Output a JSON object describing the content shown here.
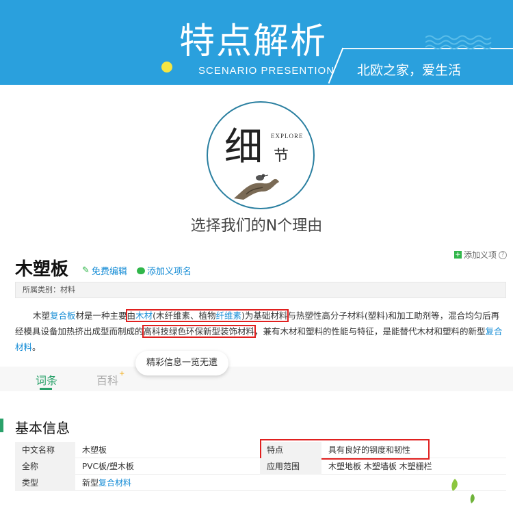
{
  "banner": {
    "title": "特点解析",
    "subtitle": "SCENARIO PRESENTION",
    "slogan": "北欧之家，爱生活"
  },
  "emblem": {
    "big_char": "细",
    "explore": "EXPLORE",
    "small_char": "节",
    "reasons": "选择我们的N个理由"
  },
  "entry": {
    "title": "木塑板",
    "edit_label": "免费编辑",
    "add_term_label": "添加义项名",
    "add_tip": "添加义项",
    "help": "?",
    "category_prefix": "所属类别：",
    "category_value": "材料"
  },
  "summary": {
    "s1": "木塑",
    "l1": "复合板",
    "s2": "材是一种主要",
    "h1a": "由",
    "h1b": "木材",
    "h1c": "(木纤维素、植物",
    "h1d": "纤维素",
    "h1e": ")为基础材料",
    "s3": "与热塑性高分子材料(塑料)和加工助剂等，混合均匀后再经模具设备加热挤出成型而制成的",
    "h2": "高科技绿色环保新型装饰材料",
    "s4": "，兼有木材和塑料的性能与特征，是能替代木材和塑料的新型",
    "l2": "复合材料",
    "s5": "。"
  },
  "tabs": {
    "active": "词条",
    "inactive": "百科",
    "star": "+",
    "pill": "精彩信息一览无遗"
  },
  "basic_info": {
    "title": "基本信息",
    "rows": [
      {
        "k1": "中文名称",
        "v1": "木塑板",
        "k2": "特点",
        "v2": "具有良好的钢度和韧性"
      },
      {
        "k1": "全称",
        "v1": "PVC板/塑木板",
        "k2": "应用范围",
        "v2": "木塑地板 木塑墙板 木塑栅栏"
      },
      {
        "k1": "类型",
        "v1_prefix": "新型",
        "v1_link": "复合材料"
      }
    ]
  },
  "colors": {
    "banner_blue": "#2aa0dd",
    "accent_green": "#2aa16a",
    "link_blue": "#138bd5",
    "highlight_red": "#e0201f"
  }
}
